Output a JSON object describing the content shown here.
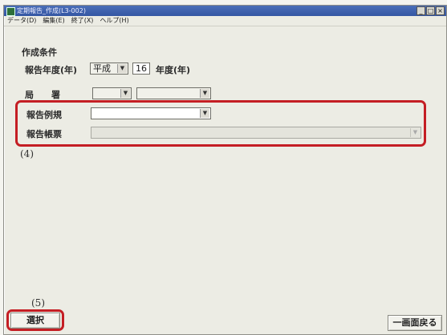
{
  "window": {
    "title": "定期報告_作成(L3-002)"
  },
  "menubar": {
    "items": [
      "データ(D)",
      "編集(E)",
      "終了(X)",
      "ヘルプ(H)"
    ]
  },
  "conditions": {
    "heading": "作成条件",
    "report_year_label": "報告年度(年)",
    "era_value": "平成",
    "year_value": "16",
    "year_suffix": "年度(年)",
    "bureau_label": "局　　署",
    "bureau_value": "",
    "office_value": "",
    "report_rule_label": "報告例規",
    "report_rule_value": "",
    "report_form_label": "報告帳票",
    "report_form_value": ""
  },
  "annotations": {
    "note_4": "(4)",
    "note_5": "(5)"
  },
  "footer": {
    "select_label": "選択",
    "back_label": "一画面戻る"
  },
  "colors": {
    "highlight": "#c41e24",
    "titlebar": "#3456a3"
  }
}
